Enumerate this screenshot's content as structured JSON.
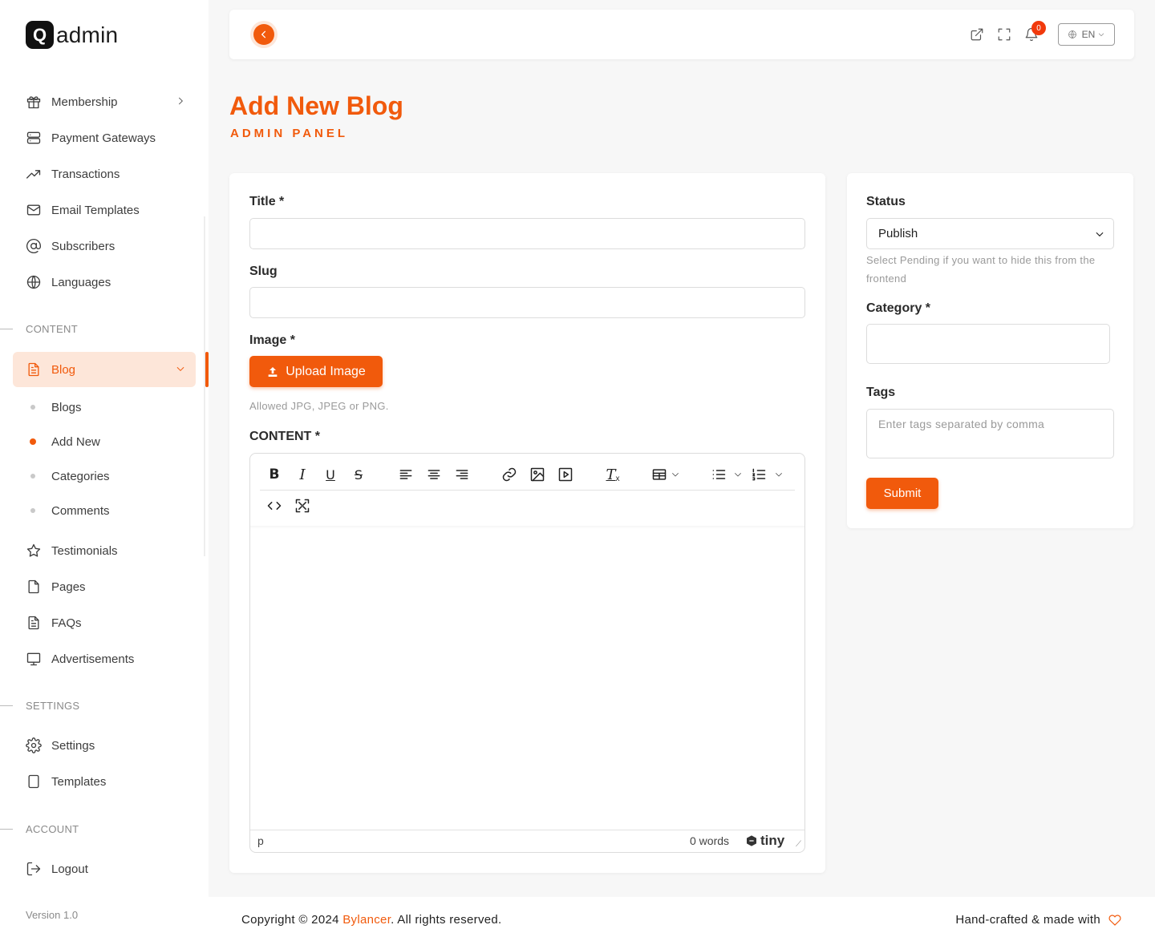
{
  "app": {
    "logo_letter": "Q",
    "logo_text": "admin",
    "version": "Version 1.0"
  },
  "sidebar": {
    "items_top": [
      {
        "label": "Membership",
        "icon": "gift-icon"
      },
      {
        "label": "Payment Gateways",
        "icon": "server-icon"
      },
      {
        "label": "Transactions",
        "icon": "trending-up-icon"
      },
      {
        "label": "Email Templates",
        "icon": "mail-icon"
      },
      {
        "label": "Subscribers",
        "icon": "at-sign-icon"
      },
      {
        "label": "Languages",
        "icon": "globe-icon"
      }
    ],
    "section_content": "CONTENT",
    "blog": {
      "label": "Blog",
      "sub": [
        "Blogs",
        "Add New",
        "Categories",
        "Comments"
      ]
    },
    "items_content": [
      {
        "label": "Testimonials",
        "icon": "star-icon"
      },
      {
        "label": "Pages",
        "icon": "file-icon"
      },
      {
        "label": "FAQs",
        "icon": "file-text-icon"
      },
      {
        "label": "Advertisements",
        "icon": "monitor-icon"
      }
    ],
    "section_settings": "SETTINGS",
    "items_settings": [
      {
        "label": "Settings",
        "icon": "gear-icon"
      },
      {
        "label": "Templates",
        "icon": "tablet-icon"
      }
    ],
    "section_account": "ACCOUNT",
    "logout": "Logout"
  },
  "topbar": {
    "notification_count": "0",
    "language": "EN"
  },
  "page": {
    "title": "Add New Blog",
    "subtitle": "ADMIN PANEL"
  },
  "form": {
    "title_label": "Title *",
    "slug_label": "Slug",
    "image_label": "Image *",
    "upload_button": "Upload Image",
    "image_hint": "Allowed JPG, JPEG or PNG.",
    "content_label": "CONTENT *",
    "editor_path": "p",
    "word_count": "0 words",
    "editor_brand": "tiny"
  },
  "side": {
    "status_label": "Status",
    "status_value": "Publish",
    "status_hint": "Select Pending if you want to hide this from the frontend",
    "category_label": "Category *",
    "tags_label": "Tags",
    "tags_placeholder": "Enter tags separated by comma",
    "submit": "Submit"
  },
  "footer": {
    "copy_prefix": "Copyright © 2024 ",
    "brand": "Bylancer",
    "copy_suffix": ". All rights reserved.",
    "made_with": "Hand-crafted & made with"
  },
  "colors": {
    "accent": "#f15a0c",
    "accent_light": "#fde6d9"
  }
}
